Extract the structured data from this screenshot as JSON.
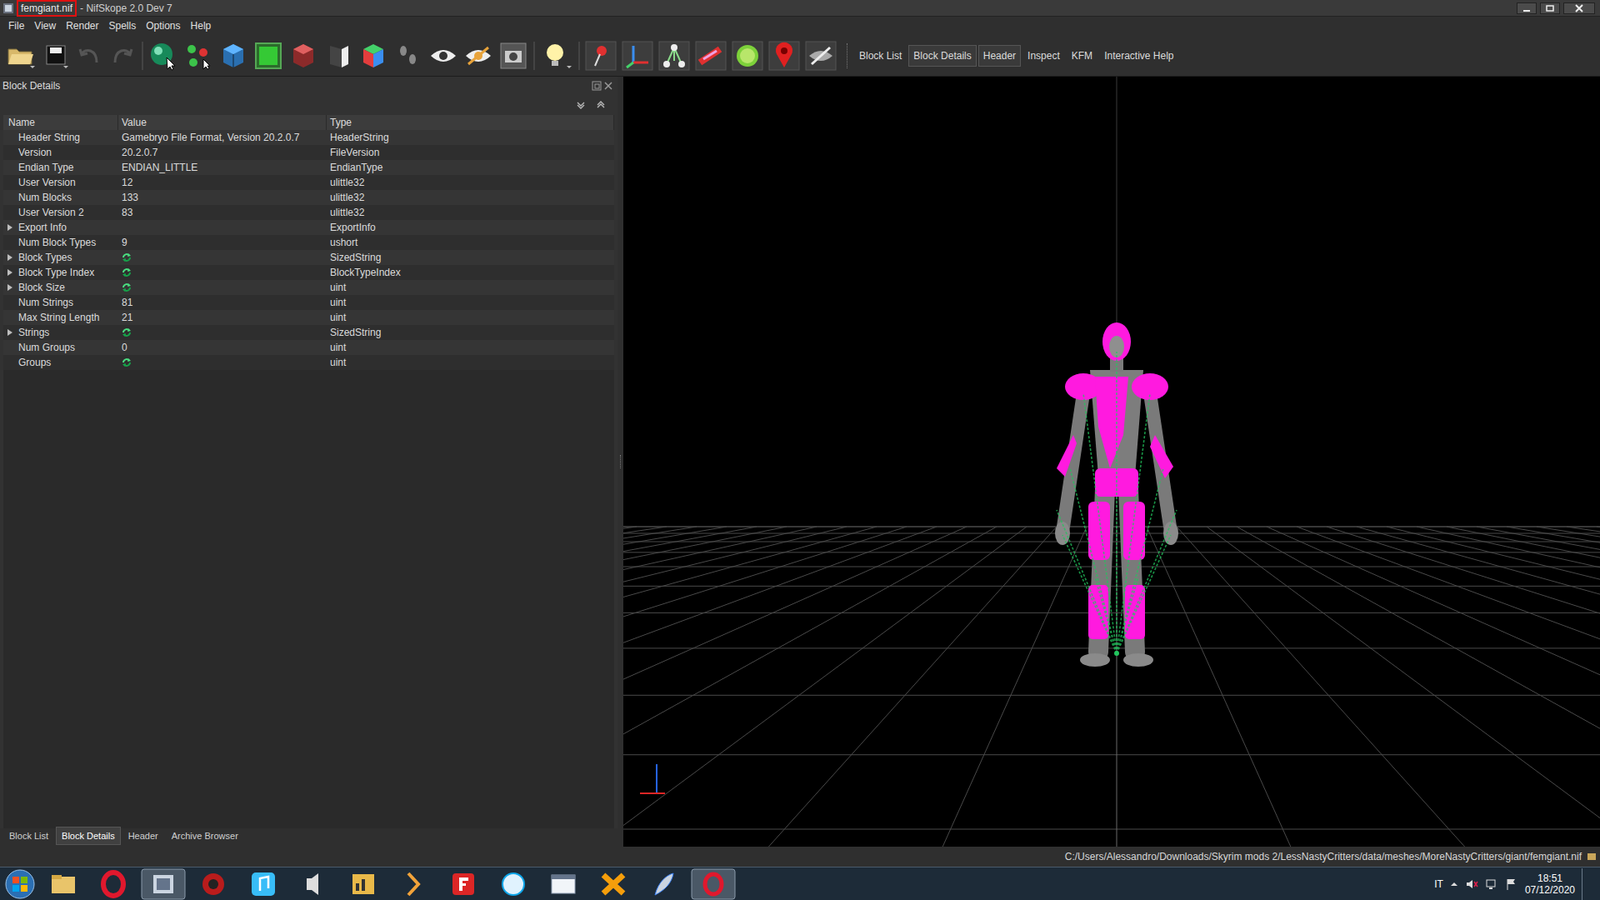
{
  "window": {
    "file": "femgiant.nif",
    "title_rest": "- NifSkope 2.0 Dev 7",
    "file_highlighted": true
  },
  "menu": [
    "File",
    "View",
    "Render",
    "Spells",
    "Options",
    "Help"
  ],
  "toolbar": {
    "docks": [
      {
        "label": "Block List",
        "active": false
      },
      {
        "label": "Block Details",
        "active": true
      },
      {
        "label": "Header",
        "active": true
      },
      {
        "label": "Inspect",
        "active": false
      },
      {
        "label": "KFM",
        "active": false
      },
      {
        "label": "Interactive Help",
        "active": false
      }
    ]
  },
  "panel": {
    "title": "Block Details",
    "columns": [
      "Name",
      "Value",
      "Type"
    ],
    "rows": [
      {
        "name": "Header String",
        "value": "Gamebryo File Format, Version 20.2.0.7",
        "type": "HeaderString",
        "kind": "text",
        "expandable": false,
        "expanded": false
      },
      {
        "name": "Version",
        "value": "20.2.0.7",
        "type": "FileVersion",
        "kind": "text",
        "expandable": false,
        "expanded": false
      },
      {
        "name": "Endian Type",
        "value": "ENDIAN_LITTLE",
        "type": "EndianType",
        "kind": "text",
        "expandable": false,
        "expanded": false
      },
      {
        "name": "User Version",
        "value": "12",
        "type": "ulittle32",
        "kind": "text",
        "expandable": false,
        "expanded": false
      },
      {
        "name": "Num Blocks",
        "value": "133",
        "type": "ulittle32",
        "kind": "text",
        "expandable": false,
        "expanded": false
      },
      {
        "name": "User Version 2",
        "value": "83",
        "type": "ulittle32",
        "kind": "text",
        "expandable": false,
        "expanded": false
      },
      {
        "name": "Export Info",
        "value": "",
        "type": "ExportInfo",
        "kind": "text",
        "expandable": true,
        "expanded": false
      },
      {
        "name": "Num Block Types",
        "value": "9",
        "type": "ushort",
        "kind": "text",
        "expandable": false,
        "expanded": false
      },
      {
        "name": "Block Types",
        "type": "SizedString",
        "kind": "array",
        "expandable": true,
        "expanded": false
      },
      {
        "name": "Block Type Index",
        "type": "BlockTypeIndex",
        "kind": "array",
        "expandable": true,
        "expanded": false
      },
      {
        "name": "Block Size",
        "type": "uint",
        "kind": "array",
        "expandable": true,
        "expanded": false
      },
      {
        "name": "Num Strings",
        "value": "81",
        "type": "uint",
        "kind": "text",
        "expandable": false,
        "expanded": false
      },
      {
        "name": "Max String Length",
        "value": "21",
        "type": "uint",
        "kind": "text",
        "expandable": false,
        "expanded": false
      },
      {
        "name": "Strings",
        "type": "SizedString",
        "kind": "array",
        "expandable": true,
        "expanded": false
      },
      {
        "name": "Num Groups",
        "value": "0",
        "type": "uint",
        "kind": "text",
        "expandable": false,
        "expanded": false
      },
      {
        "name": "Groups",
        "type": "uint",
        "kind": "array",
        "expandable": false,
        "expanded": false
      }
    ]
  },
  "bottom_tabs": [
    {
      "label": "Block List",
      "selected": false
    },
    {
      "label": "Block Details",
      "selected": true
    },
    {
      "label": "Header",
      "selected": false
    },
    {
      "label": "Archive Browser",
      "selected": false
    }
  ],
  "status_bar": {
    "path": "C:/Users/Alessandro/Downloads/Skyrim mods 2/LessNastyCritters/data/meshes/MoreNastyCritters/giant/femgiant.nif"
  },
  "taskbar": {
    "language": "IT",
    "time": "18:51",
    "date": "07/12/2020"
  }
}
